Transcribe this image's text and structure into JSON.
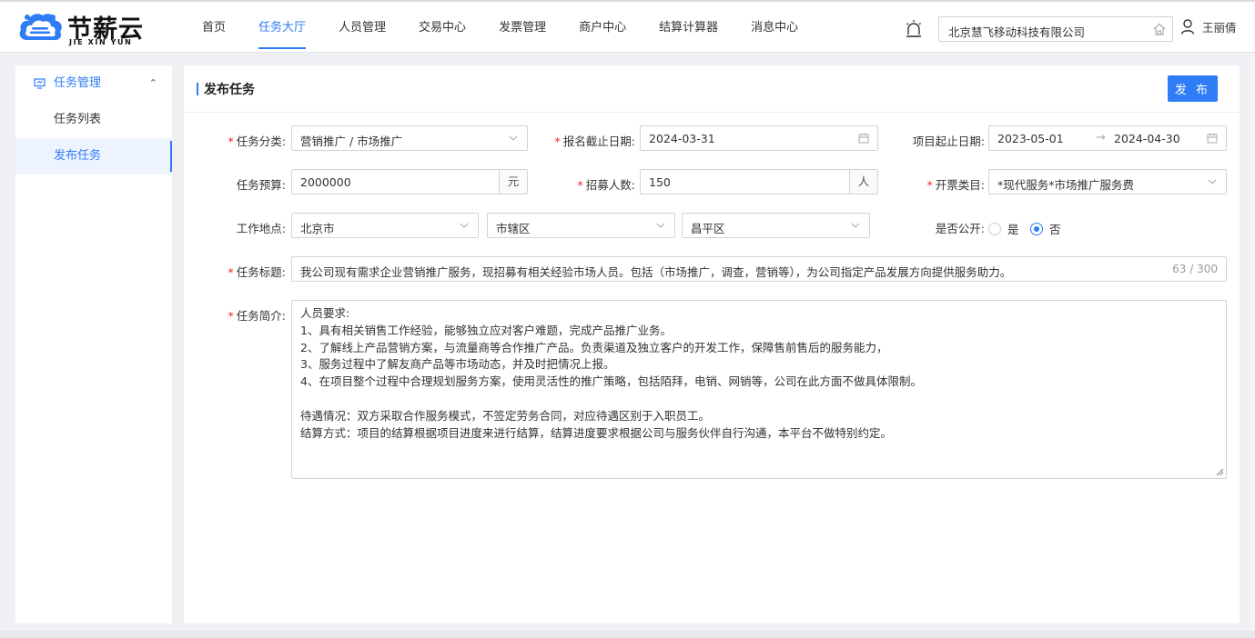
{
  "brand": {
    "name": "节薪云",
    "sub": "JIE XIN YUN"
  },
  "nav": [
    "首页",
    "任务大厅",
    "人员管理",
    "交易中心",
    "发票管理",
    "商户中心",
    "结算计算器",
    "消息中心"
  ],
  "company": "北京慧飞移动科技有限公司",
  "user": {
    "name": "王丽倩"
  },
  "sidebar": {
    "group": "任务管理",
    "items": [
      "任务列表",
      "发布任务"
    ]
  },
  "main": {
    "title": "发布任务",
    "publish_label": "发 布"
  },
  "form": {
    "category_label": "任务分类:",
    "category_value": "营销推广 / 市场推广",
    "deadline_label": "报名截止日期:",
    "deadline_value": "2024-03-31",
    "period_label": "项目起止日期:",
    "period_start": "2023-05-01",
    "period_arrow": "→",
    "period_end": "2024-04-30",
    "budget_label": "任务预算:",
    "budget_value": "2000000",
    "budget_unit": "元",
    "recruit_label": "招募人数:",
    "recruit_value": "150",
    "recruit_unit": "人",
    "invoice_label": "开票类目:",
    "invoice_value": "*现代服务*市场推广服务费",
    "location_label": "工作地点:",
    "location_city": "北京市",
    "location_area": "市辖区",
    "location_district": "昌平区",
    "public_label": "是否公开:",
    "public_yes": "是",
    "public_no": "否",
    "public_selected": "否",
    "task_title_label": "任务标题:",
    "task_title_value": "我公司现有需求企业营销推广服务，现招募有相关经验市场人员。包括（市场推广，调查，营销等），为公司指定产品发展方向提供服务助力。",
    "task_title_counter": "63 / 300",
    "intro_label": "任务简介:",
    "intro_lines": [
      "人员要求:",
      " 1、具有相关销售工作经验，能够独立应对客户难题，完成产品推广业务。",
      " 2、了解线上产品营销方案，与流量商等合作推广产品。负责渠道及独立客户的开发工作，保障售前售后的服务能力，",
      " 3、服务过程中了解友商产品等市场动态，并及时把情况上报。",
      " 4、在项目整个过程中合理规划服务方案，使用灵活性的推广策略，包括陌拜，电销、网销等，公司在此方面不做具体限制。",
      "",
      "待遇情况：双方采取合作服务模式，不签定劳务合同，对应待遇区别于入职员工。",
      "结算方式：项目的结算根据项目进度来进行结算，结算进度要求根据公司与服务伙伴自行沟通，本平台不做特别约定。"
    ]
  },
  "colors": {
    "accent": "#2e7cf6",
    "required": "#f5222d"
  }
}
